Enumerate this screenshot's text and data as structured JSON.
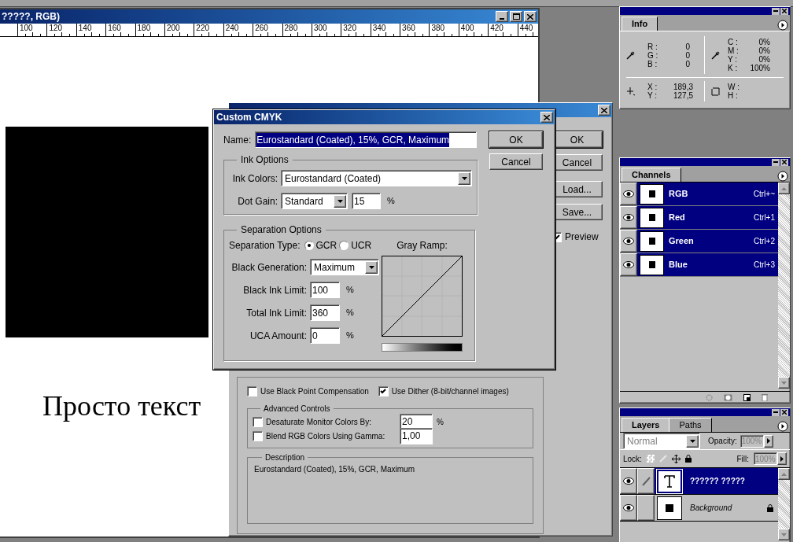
{
  "document": {
    "title": "?????, RGB)",
    "ruler_labels": [
      "100",
      "120",
      "140",
      "160",
      "180",
      "200",
      "220",
      "240",
      "260",
      "280",
      "300",
      "320",
      "340",
      "360",
      "380",
      "400",
      "420",
      "440"
    ],
    "canvas_text": "Просто текст"
  },
  "color_settings": {
    "buttons": [
      {
        "label": "OK",
        "default": true
      },
      {
        "label": "Cancel",
        "default": false
      },
      {
        "label": "Load...",
        "default": false
      },
      {
        "label": "Save...",
        "default": false
      }
    ],
    "preview": {
      "label": "Preview",
      "checked": true
    },
    "conversion_options": [
      {
        "label": "Use Black Point Compensation",
        "checked": false
      },
      {
        "label": "Use Dither (8-bit/channel images)",
        "checked": true
      }
    ],
    "advanced_controls": {
      "title": "Advanced Controls",
      "rows": [
        {
          "label": "Desaturate Monitor Colors By:",
          "checked": false,
          "value": "20",
          "unit": "%"
        },
        {
          "label": "Blend RGB Colors Using Gamma:",
          "checked": false,
          "value": "1,00"
        }
      ]
    },
    "description": {
      "title": "Description",
      "text": "Eurostandard (Coated), 15%, GCR, Maximum"
    }
  },
  "custom_cmyk": {
    "title": "Custom CMYK",
    "name": {
      "label": "Name:",
      "value": "Eurostandard (Coated), 15%, GCR, Maximum",
      "text_selected": true
    },
    "buttons": [
      {
        "label": "OK",
        "default": true
      },
      {
        "label": "Cancel",
        "default": false
      }
    ],
    "ink_options": {
      "title": "Ink Options",
      "ink_colors": {
        "label": "Ink Colors:",
        "value": "Eurostandard (Coated)"
      },
      "dot_gain": {
        "label": "Dot Gain:",
        "value": "Standard",
        "amount": "15",
        "unit": "%"
      }
    },
    "separation_options": {
      "title": "Separation Options",
      "separation_type": {
        "label": "Separation Type:",
        "options": [
          {
            "label": "GCR",
            "selected": true
          },
          {
            "label": "UCR",
            "selected": false
          }
        ]
      },
      "black_generation": {
        "label": "Black Generation:",
        "value": "Maximum"
      },
      "limits": [
        {
          "label": "Black Ink Limit:",
          "value": "100",
          "unit": "%"
        },
        {
          "label": "Total Ink Limit:",
          "value": "360",
          "unit": "%"
        },
        {
          "label": "UCA Amount:",
          "value": "0",
          "unit": "%"
        }
      ],
      "gray_ramp": {
        "label": "Gray Ramp:"
      }
    }
  },
  "info": {
    "tab": "Info",
    "rgb": [
      {
        "label": "R :",
        "value": "0"
      },
      {
        "label": "G :",
        "value": "0"
      },
      {
        "label": "B :",
        "value": "0"
      }
    ],
    "cmyk": [
      {
        "label": "C :",
        "value": "0%"
      },
      {
        "label": "M :",
        "value": "0%"
      },
      {
        "label": "Y :",
        "value": "0%"
      },
      {
        "label": "K :",
        "value": "100%"
      }
    ],
    "position": [
      {
        "label": "X :",
        "value": "189,3"
      },
      {
        "label": "Y :",
        "value": "127,5"
      }
    ],
    "size": [
      {
        "label": "W :"
      },
      {
        "label": "H :"
      }
    ]
  },
  "channels": {
    "tab": "Channels",
    "rows": [
      {
        "name": "RGB",
        "shortcut": "Ctrl+~",
        "selected": true,
        "visible": true
      },
      {
        "name": "Red",
        "shortcut": "Ctrl+1",
        "selected": true,
        "visible": true
      },
      {
        "name": "Green",
        "shortcut": "Ctrl+2",
        "selected": true,
        "visible": true
      },
      {
        "name": "Blue",
        "shortcut": "Ctrl+3",
        "selected": true,
        "visible": true
      }
    ]
  },
  "layers": {
    "tabs": [
      {
        "label": "Layers",
        "selected": true
      },
      {
        "label": "Paths",
        "selected": false
      }
    ],
    "blend_mode": {
      "value": "Normal",
      "disabled": true
    },
    "opacity": {
      "label": "Opacity:",
      "value": "100%",
      "disabled": true
    },
    "lock": {
      "label": "Lock:"
    },
    "fill": {
      "label": "Fill:",
      "value": "100%",
      "disabled": true
    },
    "rows": [
      {
        "name": "?????? ?????",
        "kind": "text",
        "selected": true,
        "visible": true,
        "locked": false
      },
      {
        "name": "Background",
        "kind": "image",
        "selected": false,
        "visible": true,
        "locked": true
      }
    ]
  }
}
